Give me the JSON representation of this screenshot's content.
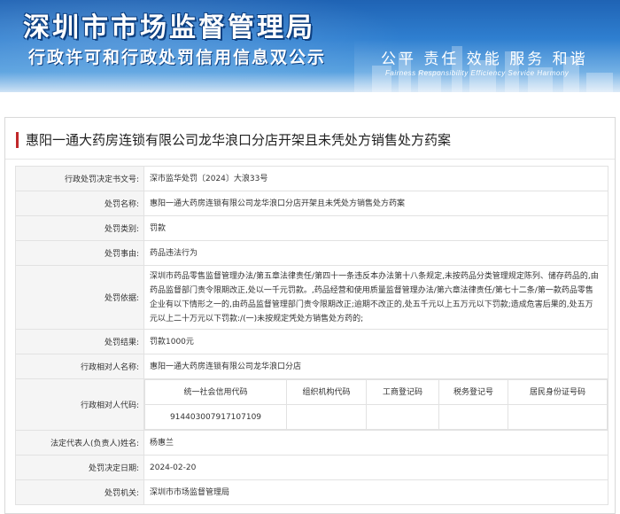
{
  "banner": {
    "title": "深圳市市场监督管理局",
    "subtitle": "行政许可和行政处罚信用信息双公示",
    "values": "公平  责任  效能  服务  和谐",
    "values_en": "Fairness  Responsibility  Efficiency  Service  Harmony"
  },
  "case": {
    "title": "惠阳一通大药房连锁有限公司龙华浪口分店开架且未凭处方销售处方药案"
  },
  "details": {
    "decision_no": {
      "label": "行政处罚决定书文号:",
      "value": "深市监华处罚〔2024〕大浪33号"
    },
    "penalty_name": {
      "label": "处罚名称:",
      "value": "惠阳一通大药房连锁有限公司龙华浪口分店开架且未凭处方销售处方药案"
    },
    "penalty_type": {
      "label": "处罚类别:",
      "value": "罚款"
    },
    "penalty_cause": {
      "label": "处罚事由:",
      "value": "药品违法行为"
    },
    "penalty_basis": {
      "label": "处罚依据:",
      "value": "深圳市药品零售监督管理办法/第五章法律责任/第四十一条违反本办法第十八条规定,未按药品分类管理规定陈列、储存药品的,由药品监督部门责令限期改正,处以一千元罚款。,药品经营和使用质量监督管理办法/第六章法律责任/第七十二条/第一款药品零售企业有以下情形之一的,由药品监督管理部门责令限期改正;逾期不改正的,处五千元以上五万元以下罚款;造成危害后果的,处五万元以上二十万元以下罚款:/(一)未按规定凭处方销售处方药的;"
    },
    "penalty_result": {
      "label": "处罚结果:",
      "value": "罚款1000元"
    },
    "counterparty_name": {
      "label": "行政相对人名称:",
      "value": "惠阳一通大药房连锁有限公司龙华浪口分店"
    },
    "counterparty_codes": {
      "label": "行政相对人代码:",
      "headers": [
        "统一社会信用代码",
        "组织机构代码",
        "工商登记码",
        "税务登记号",
        "居民身份证号码"
      ],
      "values": [
        "914403007917107109",
        "",
        "",
        "",
        ""
      ]
    },
    "legal_rep": {
      "label": "法定代表人(负责人)姓名:",
      "value": "杨惠兰"
    },
    "decision_date": {
      "label": "处罚决定日期:",
      "value": "2024-02-20"
    },
    "authority": {
      "label": "处罚机关:",
      "value": "深圳市市场监督管理局"
    }
  }
}
